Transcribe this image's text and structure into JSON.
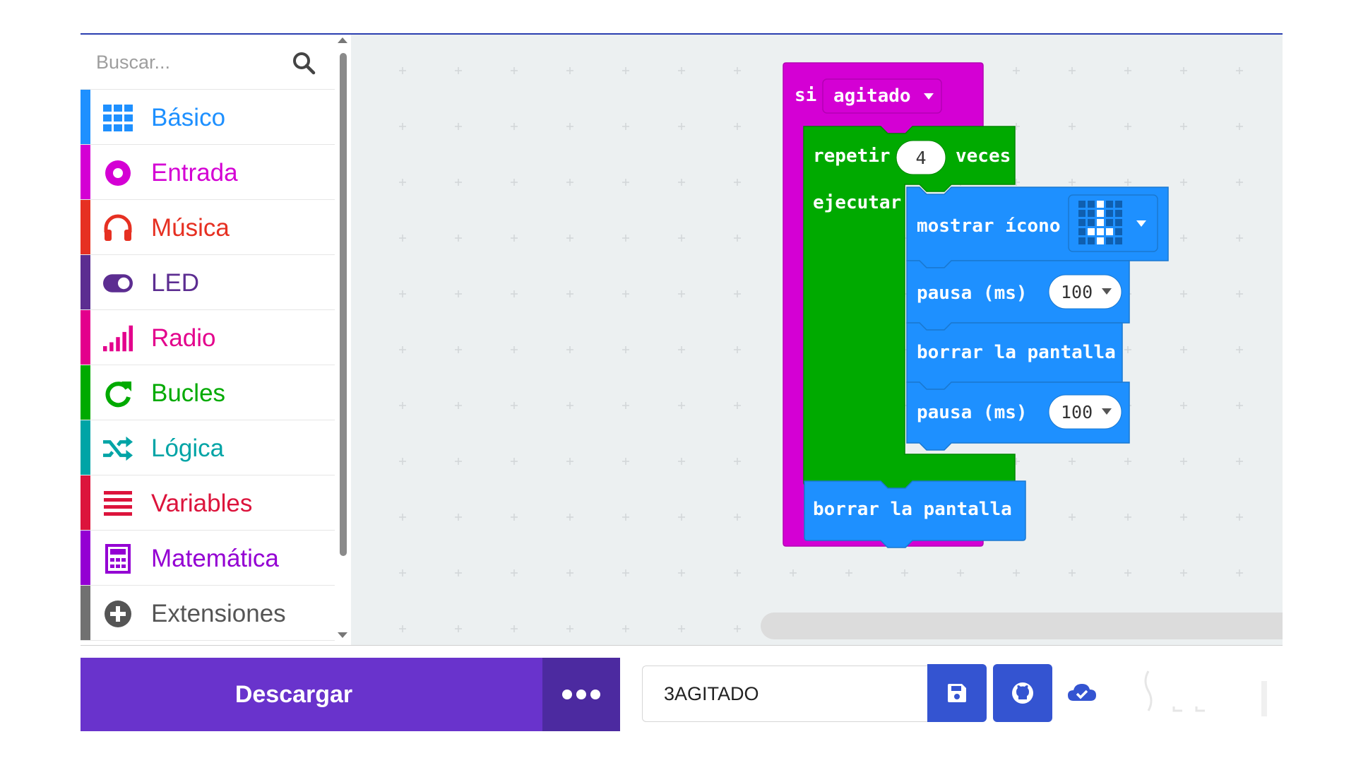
{
  "search": {
    "placeholder": "Buscar..."
  },
  "categories": [
    {
      "label": "Básico",
      "color": "#1e90ff",
      "icon": "grid-icon"
    },
    {
      "label": "Entrada",
      "color": "#d400d4",
      "icon": "target-icon"
    },
    {
      "label": "Música",
      "color": "#e63022",
      "icon": "headphones-icon"
    },
    {
      "label": "LED",
      "color": "#5c2d91",
      "icon": "toggle-icon"
    },
    {
      "label": "Radio",
      "color": "#e3008c",
      "icon": "signal-bars-icon"
    },
    {
      "label": "Bucles",
      "color": "#00aa00",
      "icon": "loop-arrow-icon"
    },
    {
      "label": "Lógica",
      "color": "#00a4a6",
      "icon": "shuffle-icon"
    },
    {
      "label": "Variables",
      "color": "#dc143c",
      "icon": "list-lines-icon"
    },
    {
      "label": "Matemática",
      "color": "#9400d3",
      "icon": "calculator-icon"
    },
    {
      "label": "Extensiones",
      "color": "#717171",
      "icon": "plus-circle-icon"
    }
  ],
  "blocks": {
    "si_label": "si",
    "agitado_label": "agitado",
    "repetir_label": "repetir",
    "repeat_count": "4",
    "veces_label": "veces",
    "ejecutar_label": "ejecutar",
    "mostrar_icono_label": "mostrar ícono",
    "pausa1_label": "pausa (ms)",
    "pausa1_value": "100",
    "borrar1_label": "borrar la pantalla",
    "pausa2_label": "pausa (ms)",
    "pausa2_value": "100",
    "borrar2_label": "borrar la pantalla"
  },
  "bottombar": {
    "download_label": "Descargar",
    "project_name": "3AGITADO"
  }
}
